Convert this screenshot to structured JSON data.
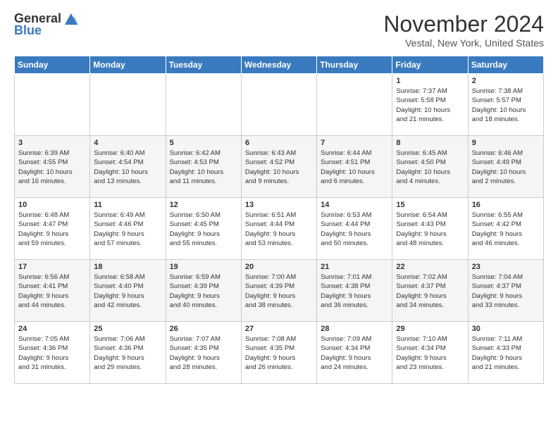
{
  "header": {
    "logo_line1": "General",
    "logo_line2": "Blue",
    "month_title": "November 2024",
    "location": "Vestal, New York, United States"
  },
  "weekdays": [
    "Sunday",
    "Monday",
    "Tuesday",
    "Wednesday",
    "Thursday",
    "Friday",
    "Saturday"
  ],
  "weeks": [
    [
      {
        "day": "",
        "info": ""
      },
      {
        "day": "",
        "info": ""
      },
      {
        "day": "",
        "info": ""
      },
      {
        "day": "",
        "info": ""
      },
      {
        "day": "",
        "info": ""
      },
      {
        "day": "1",
        "info": "Sunrise: 7:37 AM\nSunset: 5:58 PM\nDaylight: 10 hours\nand 21 minutes."
      },
      {
        "day": "2",
        "info": "Sunrise: 7:38 AM\nSunset: 5:57 PM\nDaylight: 10 hours\nand 18 minutes."
      }
    ],
    [
      {
        "day": "3",
        "info": "Sunrise: 6:39 AM\nSunset: 4:55 PM\nDaylight: 10 hours\nand 16 minutes."
      },
      {
        "day": "4",
        "info": "Sunrise: 6:40 AM\nSunset: 4:54 PM\nDaylight: 10 hours\nand 13 minutes."
      },
      {
        "day": "5",
        "info": "Sunrise: 6:42 AM\nSunset: 4:53 PM\nDaylight: 10 hours\nand 11 minutes."
      },
      {
        "day": "6",
        "info": "Sunrise: 6:43 AM\nSunset: 4:52 PM\nDaylight: 10 hours\nand 9 minutes."
      },
      {
        "day": "7",
        "info": "Sunrise: 6:44 AM\nSunset: 4:51 PM\nDaylight: 10 hours\nand 6 minutes."
      },
      {
        "day": "8",
        "info": "Sunrise: 6:45 AM\nSunset: 4:50 PM\nDaylight: 10 hours\nand 4 minutes."
      },
      {
        "day": "9",
        "info": "Sunrise: 6:46 AM\nSunset: 4:49 PM\nDaylight: 10 hours\nand 2 minutes."
      }
    ],
    [
      {
        "day": "10",
        "info": "Sunrise: 6:48 AM\nSunset: 4:47 PM\nDaylight: 9 hours\nand 59 minutes."
      },
      {
        "day": "11",
        "info": "Sunrise: 6:49 AM\nSunset: 4:46 PM\nDaylight: 9 hours\nand 57 minutes."
      },
      {
        "day": "12",
        "info": "Sunrise: 6:50 AM\nSunset: 4:45 PM\nDaylight: 9 hours\nand 55 minutes."
      },
      {
        "day": "13",
        "info": "Sunrise: 6:51 AM\nSunset: 4:44 PM\nDaylight: 9 hours\nand 53 minutes."
      },
      {
        "day": "14",
        "info": "Sunrise: 6:53 AM\nSunset: 4:44 PM\nDaylight: 9 hours\nand 50 minutes."
      },
      {
        "day": "15",
        "info": "Sunrise: 6:54 AM\nSunset: 4:43 PM\nDaylight: 9 hours\nand 48 minutes."
      },
      {
        "day": "16",
        "info": "Sunrise: 6:55 AM\nSunset: 4:42 PM\nDaylight: 9 hours\nand 46 minutes."
      }
    ],
    [
      {
        "day": "17",
        "info": "Sunrise: 6:56 AM\nSunset: 4:41 PM\nDaylight: 9 hours\nand 44 minutes."
      },
      {
        "day": "18",
        "info": "Sunrise: 6:58 AM\nSunset: 4:40 PM\nDaylight: 9 hours\nand 42 minutes."
      },
      {
        "day": "19",
        "info": "Sunrise: 6:59 AM\nSunset: 4:39 PM\nDaylight: 9 hours\nand 40 minutes."
      },
      {
        "day": "20",
        "info": "Sunrise: 7:00 AM\nSunset: 4:39 PM\nDaylight: 9 hours\nand 38 minutes."
      },
      {
        "day": "21",
        "info": "Sunrise: 7:01 AM\nSunset: 4:38 PM\nDaylight: 9 hours\nand 36 minutes."
      },
      {
        "day": "22",
        "info": "Sunrise: 7:02 AM\nSunset: 4:37 PM\nDaylight: 9 hours\nand 34 minutes."
      },
      {
        "day": "23",
        "info": "Sunrise: 7:04 AM\nSunset: 4:37 PM\nDaylight: 9 hours\nand 33 minutes."
      }
    ],
    [
      {
        "day": "24",
        "info": "Sunrise: 7:05 AM\nSunset: 4:36 PM\nDaylight: 9 hours\nand 31 minutes."
      },
      {
        "day": "25",
        "info": "Sunrise: 7:06 AM\nSunset: 4:36 PM\nDaylight: 9 hours\nand 29 minutes."
      },
      {
        "day": "26",
        "info": "Sunrise: 7:07 AM\nSunset: 4:35 PM\nDaylight: 9 hours\nand 28 minutes."
      },
      {
        "day": "27",
        "info": "Sunrise: 7:08 AM\nSunset: 4:35 PM\nDaylight: 9 hours\nand 26 minutes."
      },
      {
        "day": "28",
        "info": "Sunrise: 7:09 AM\nSunset: 4:34 PM\nDaylight: 9 hours\nand 24 minutes."
      },
      {
        "day": "29",
        "info": "Sunrise: 7:10 AM\nSunset: 4:34 PM\nDaylight: 9 hours\nand 23 minutes."
      },
      {
        "day": "30",
        "info": "Sunrise: 7:11 AM\nSunset: 4:33 PM\nDaylight: 9 hours\nand 21 minutes."
      }
    ]
  ]
}
